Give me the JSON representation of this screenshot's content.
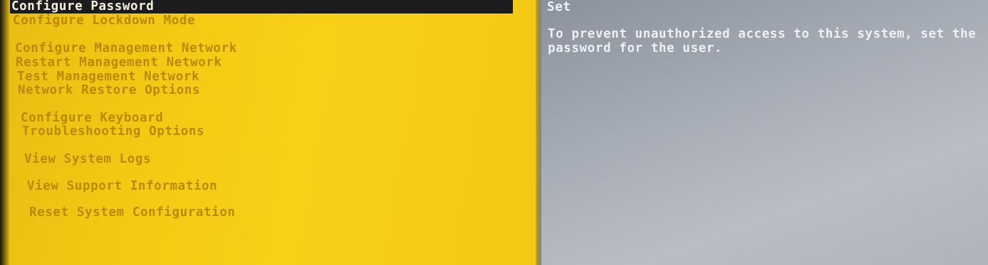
{
  "menu": {
    "items": [
      {
        "label": "Configure Password",
        "selected": true
      },
      {
        "label": "Configure Lockdown Mode",
        "selected": false
      },
      {
        "label": "Configure Management Network",
        "selected": false
      },
      {
        "label": "Restart Management Network",
        "selected": false
      },
      {
        "label": "Test Management Network",
        "selected": false
      },
      {
        "label": "Network Restore Options",
        "selected": false
      },
      {
        "label": "Configure Keyboard",
        "selected": false
      },
      {
        "label": "Troubleshooting Options",
        "selected": false
      },
      {
        "label": "View System Logs",
        "selected": false
      },
      {
        "label": "View Support Information",
        "selected": false
      },
      {
        "label": "Reset System Configuration",
        "selected": false
      }
    ]
  },
  "details": {
    "title": "Set",
    "description": "To prevent unauthorized access to this system, set the password for the user."
  },
  "colors": {
    "menu_background": "#f6cd16",
    "menu_text": "#b98a08",
    "selected_background": "#1c1c1e",
    "selected_text": "#f6f2dc",
    "info_background": "#a7adb6",
    "info_text": "#eef0f3"
  }
}
